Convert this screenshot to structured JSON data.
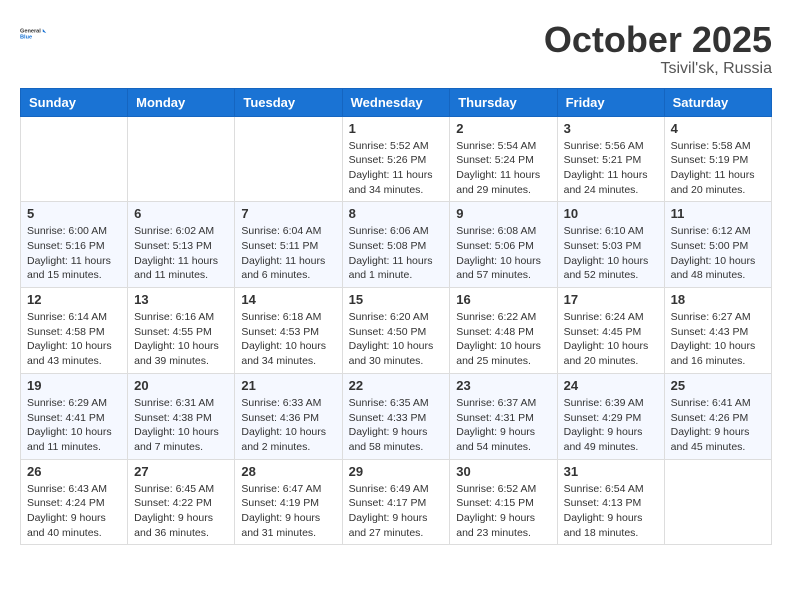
{
  "logo": {
    "line1": "General",
    "line2": "Blue"
  },
  "header": {
    "month": "October 2025",
    "location": "Tsivil'sk, Russia"
  },
  "weekdays": [
    "Sunday",
    "Monday",
    "Tuesday",
    "Wednesday",
    "Thursday",
    "Friday",
    "Saturday"
  ],
  "weeks": [
    [
      {
        "day": "",
        "info": ""
      },
      {
        "day": "",
        "info": ""
      },
      {
        "day": "",
        "info": ""
      },
      {
        "day": "1",
        "info": "Sunrise: 5:52 AM\nSunset: 5:26 PM\nDaylight: 11 hours\nand 34 minutes."
      },
      {
        "day": "2",
        "info": "Sunrise: 5:54 AM\nSunset: 5:24 PM\nDaylight: 11 hours\nand 29 minutes."
      },
      {
        "day": "3",
        "info": "Sunrise: 5:56 AM\nSunset: 5:21 PM\nDaylight: 11 hours\nand 24 minutes."
      },
      {
        "day": "4",
        "info": "Sunrise: 5:58 AM\nSunset: 5:19 PM\nDaylight: 11 hours\nand 20 minutes."
      }
    ],
    [
      {
        "day": "5",
        "info": "Sunrise: 6:00 AM\nSunset: 5:16 PM\nDaylight: 11 hours\nand 15 minutes."
      },
      {
        "day": "6",
        "info": "Sunrise: 6:02 AM\nSunset: 5:13 PM\nDaylight: 11 hours\nand 11 minutes."
      },
      {
        "day": "7",
        "info": "Sunrise: 6:04 AM\nSunset: 5:11 PM\nDaylight: 11 hours\nand 6 minutes."
      },
      {
        "day": "8",
        "info": "Sunrise: 6:06 AM\nSunset: 5:08 PM\nDaylight: 11 hours\nand 1 minute."
      },
      {
        "day": "9",
        "info": "Sunrise: 6:08 AM\nSunset: 5:06 PM\nDaylight: 10 hours\nand 57 minutes."
      },
      {
        "day": "10",
        "info": "Sunrise: 6:10 AM\nSunset: 5:03 PM\nDaylight: 10 hours\nand 52 minutes."
      },
      {
        "day": "11",
        "info": "Sunrise: 6:12 AM\nSunset: 5:00 PM\nDaylight: 10 hours\nand 48 minutes."
      }
    ],
    [
      {
        "day": "12",
        "info": "Sunrise: 6:14 AM\nSunset: 4:58 PM\nDaylight: 10 hours\nand 43 minutes."
      },
      {
        "day": "13",
        "info": "Sunrise: 6:16 AM\nSunset: 4:55 PM\nDaylight: 10 hours\nand 39 minutes."
      },
      {
        "day": "14",
        "info": "Sunrise: 6:18 AM\nSunset: 4:53 PM\nDaylight: 10 hours\nand 34 minutes."
      },
      {
        "day": "15",
        "info": "Sunrise: 6:20 AM\nSunset: 4:50 PM\nDaylight: 10 hours\nand 30 minutes."
      },
      {
        "day": "16",
        "info": "Sunrise: 6:22 AM\nSunset: 4:48 PM\nDaylight: 10 hours\nand 25 minutes."
      },
      {
        "day": "17",
        "info": "Sunrise: 6:24 AM\nSunset: 4:45 PM\nDaylight: 10 hours\nand 20 minutes."
      },
      {
        "day": "18",
        "info": "Sunrise: 6:27 AM\nSunset: 4:43 PM\nDaylight: 10 hours\nand 16 minutes."
      }
    ],
    [
      {
        "day": "19",
        "info": "Sunrise: 6:29 AM\nSunset: 4:41 PM\nDaylight: 10 hours\nand 11 minutes."
      },
      {
        "day": "20",
        "info": "Sunrise: 6:31 AM\nSunset: 4:38 PM\nDaylight: 10 hours\nand 7 minutes."
      },
      {
        "day": "21",
        "info": "Sunrise: 6:33 AM\nSunset: 4:36 PM\nDaylight: 10 hours\nand 2 minutes."
      },
      {
        "day": "22",
        "info": "Sunrise: 6:35 AM\nSunset: 4:33 PM\nDaylight: 9 hours\nand 58 minutes."
      },
      {
        "day": "23",
        "info": "Sunrise: 6:37 AM\nSunset: 4:31 PM\nDaylight: 9 hours\nand 54 minutes."
      },
      {
        "day": "24",
        "info": "Sunrise: 6:39 AM\nSunset: 4:29 PM\nDaylight: 9 hours\nand 49 minutes."
      },
      {
        "day": "25",
        "info": "Sunrise: 6:41 AM\nSunset: 4:26 PM\nDaylight: 9 hours\nand 45 minutes."
      }
    ],
    [
      {
        "day": "26",
        "info": "Sunrise: 6:43 AM\nSunset: 4:24 PM\nDaylight: 9 hours\nand 40 minutes."
      },
      {
        "day": "27",
        "info": "Sunrise: 6:45 AM\nSunset: 4:22 PM\nDaylight: 9 hours\nand 36 minutes."
      },
      {
        "day": "28",
        "info": "Sunrise: 6:47 AM\nSunset: 4:19 PM\nDaylight: 9 hours\nand 31 minutes."
      },
      {
        "day": "29",
        "info": "Sunrise: 6:49 AM\nSunset: 4:17 PM\nDaylight: 9 hours\nand 27 minutes."
      },
      {
        "day": "30",
        "info": "Sunrise: 6:52 AM\nSunset: 4:15 PM\nDaylight: 9 hours\nand 23 minutes."
      },
      {
        "day": "31",
        "info": "Sunrise: 6:54 AM\nSunset: 4:13 PM\nDaylight: 9 hours\nand 18 minutes."
      },
      {
        "day": "",
        "info": ""
      }
    ]
  ]
}
